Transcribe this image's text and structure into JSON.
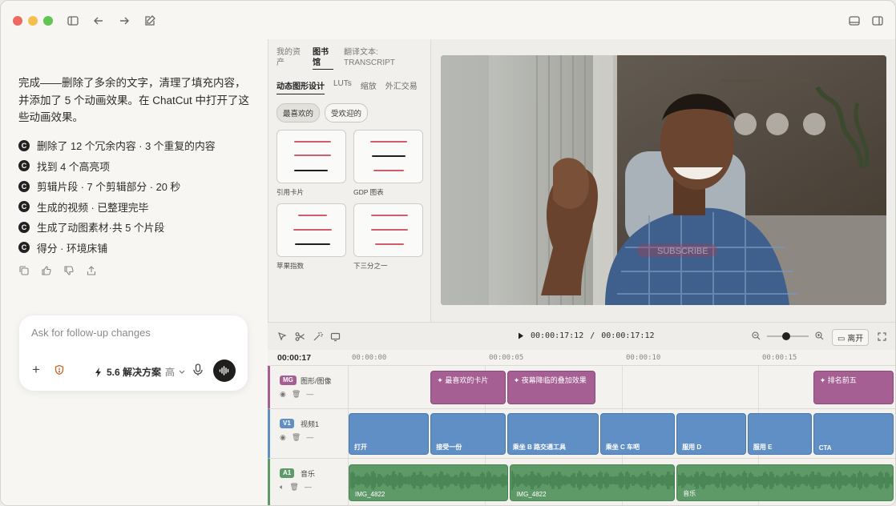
{
  "chat": {
    "message": "完成——删除了多余的文字，清理了填充内容，并添加了 5 个动画效果。在 ChatCut 中打开了这些动画效果。",
    "steps": [
      {
        "icon": "chatcut-icon",
        "text": "删除了 12 个冗余内容 · 3 个重复的内容"
      },
      {
        "icon": "chatcut-icon",
        "text": "找到 4 个高亮项"
      },
      {
        "icon": "chatcut-icon",
        "text": "剪辑片段 · 7 个剪辑部分 · 20 秒"
      },
      {
        "icon": "chatcut-icon",
        "text": "生成的视频 · 已整理完毕"
      },
      {
        "icon": "chatcut-icon",
        "text": "生成了动图素材·共 5 个片段"
      },
      {
        "icon": "chatcut-icon",
        "text": "得分 · 环境床铺"
      }
    ],
    "step_glyph": "C",
    "composer_placeholder": "Ask for follow-up changes",
    "model_label": "5.6 解决方案",
    "model_level": "高"
  },
  "library": {
    "tabs": [
      {
        "label": "我的资产",
        "active": false
      },
      {
        "label": "图书馆",
        "active": true
      },
      {
        "label": "翻译文本: TRANSCRIPT",
        "active": false
      }
    ],
    "subtabs": [
      {
        "label": "动态图形设计",
        "active": true
      },
      {
        "label": "LUTs",
        "active": false
      },
      {
        "label": "缩放",
        "active": false
      },
      {
        "label": "外汇交易",
        "active": false
      }
    ],
    "chips": [
      {
        "label": "最喜欢的",
        "active": true
      },
      {
        "label": "受欢迎的",
        "active": false
      }
    ],
    "cards": [
      {
        "label": "引用卡片"
      },
      {
        "label": "GDP 图表"
      },
      {
        "label": "苹果指数"
      },
      {
        "label": "下三分之一"
      }
    ]
  },
  "player": {
    "current_time": "00:00:17:12",
    "separator": "/",
    "total_time": "00:00:17:12",
    "leave_label": "离开",
    "overlay_text": "SUBSCRIBE"
  },
  "timeline": {
    "current": "00:00:17",
    "ruler_ticks": [
      "00:00:00",
      "00:00:05",
      "00:00:10",
      "00:00:15"
    ],
    "tracks": [
      {
        "badge": "MG",
        "name": "图形/图像",
        "color": "#a55f93",
        "clips": [
          {
            "label": "✦ 最喜欢的卡片",
            "start": 3.0,
            "end": 5.8
          },
          {
            "label": "✦ 夜幕降临的叠加效果",
            "start": 5.8,
            "end": 9.1
          },
          {
            "label": "✦ 排名前五",
            "start": 17.0,
            "end": 20.0
          }
        ]
      },
      {
        "badge": "V1",
        "name": "视频1",
        "color": "#5f8fc4",
        "clips": [
          {
            "label": "打开",
            "start": 0,
            "end": 3.0
          },
          {
            "label": "接受一份",
            "start": 3.0,
            "end": 5.8
          },
          {
            "label": "乘坐 B 路交通工具",
            "start": 5.8,
            "end": 9.2
          },
          {
            "label": "乘坐 C 车吧",
            "start": 9.2,
            "end": 12.0
          },
          {
            "label": "服用 D",
            "start": 12.0,
            "end": 14.6
          },
          {
            "label": "服用 E",
            "start": 14.6,
            "end": 17.0
          },
          {
            "label": "CTA",
            "start": 17.0,
            "end": 20.0
          }
        ]
      },
      {
        "badge": "A1",
        "name": "音乐",
        "color": "#5e9a68",
        "clips": [
          {
            "label": "IMG_4822",
            "start": 0,
            "end": 5.9
          },
          {
            "label": "IMG_4822",
            "start": 5.9,
            "end": 12.0
          },
          {
            "label": "音乐",
            "start": 12.0,
            "end": 20.0
          }
        ]
      }
    ]
  }
}
